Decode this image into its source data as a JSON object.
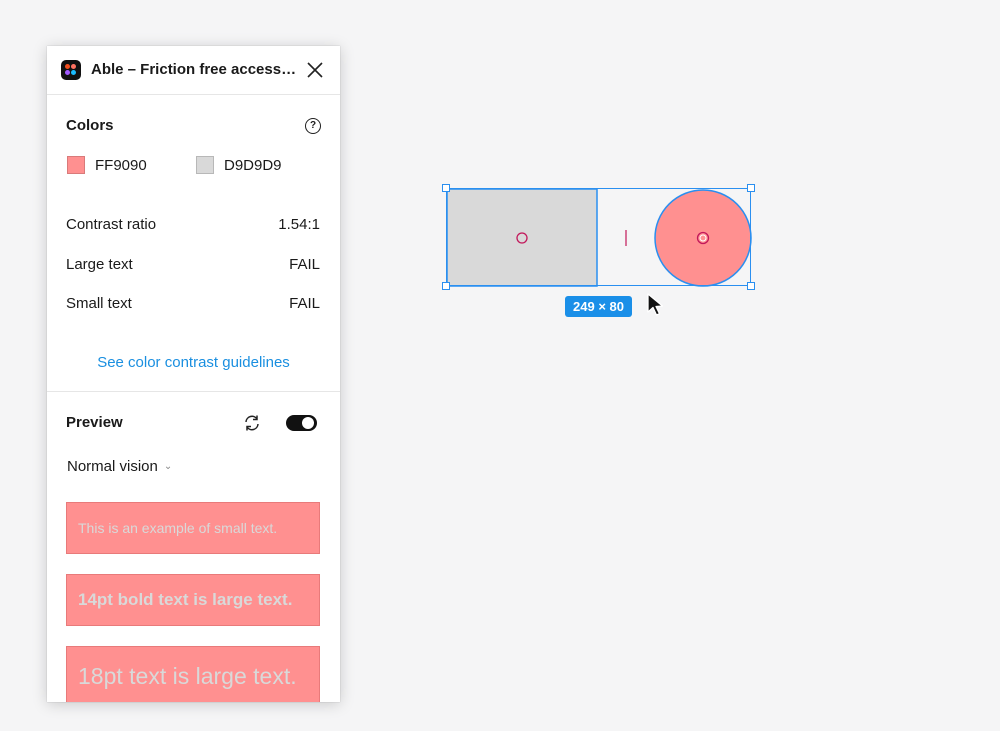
{
  "plugin": {
    "title": "Able – Friction free accessi...",
    "close_icon": "close-icon"
  },
  "colors": {
    "section_title": "Colors",
    "help_glyph": "?",
    "color1": {
      "hex": "FF9090",
      "swatch": "#FF9090"
    },
    "color2": {
      "hex": "D9D9D9",
      "swatch": "#D9D9D9"
    }
  },
  "results": {
    "contrast_label": "Contrast ratio",
    "contrast_value": "1.54:1",
    "large_label": "Large text",
    "large_value": "FAIL",
    "small_label": "Small text",
    "small_value": "FAIL"
  },
  "guidelines_link": "See color contrast guidelines",
  "preview": {
    "section_title": "Preview",
    "toggle_on": true,
    "vision_mode": "Normal vision",
    "samples": [
      "This is an example of small text.",
      "14pt bold text is large text.",
      "18pt text is large text."
    ]
  },
  "canvas": {
    "dimension_label": "249 × 80",
    "rect_fill": "#D9D9D9",
    "circle_fill": "#FF9090",
    "selection_color": "#2A8FF0"
  }
}
